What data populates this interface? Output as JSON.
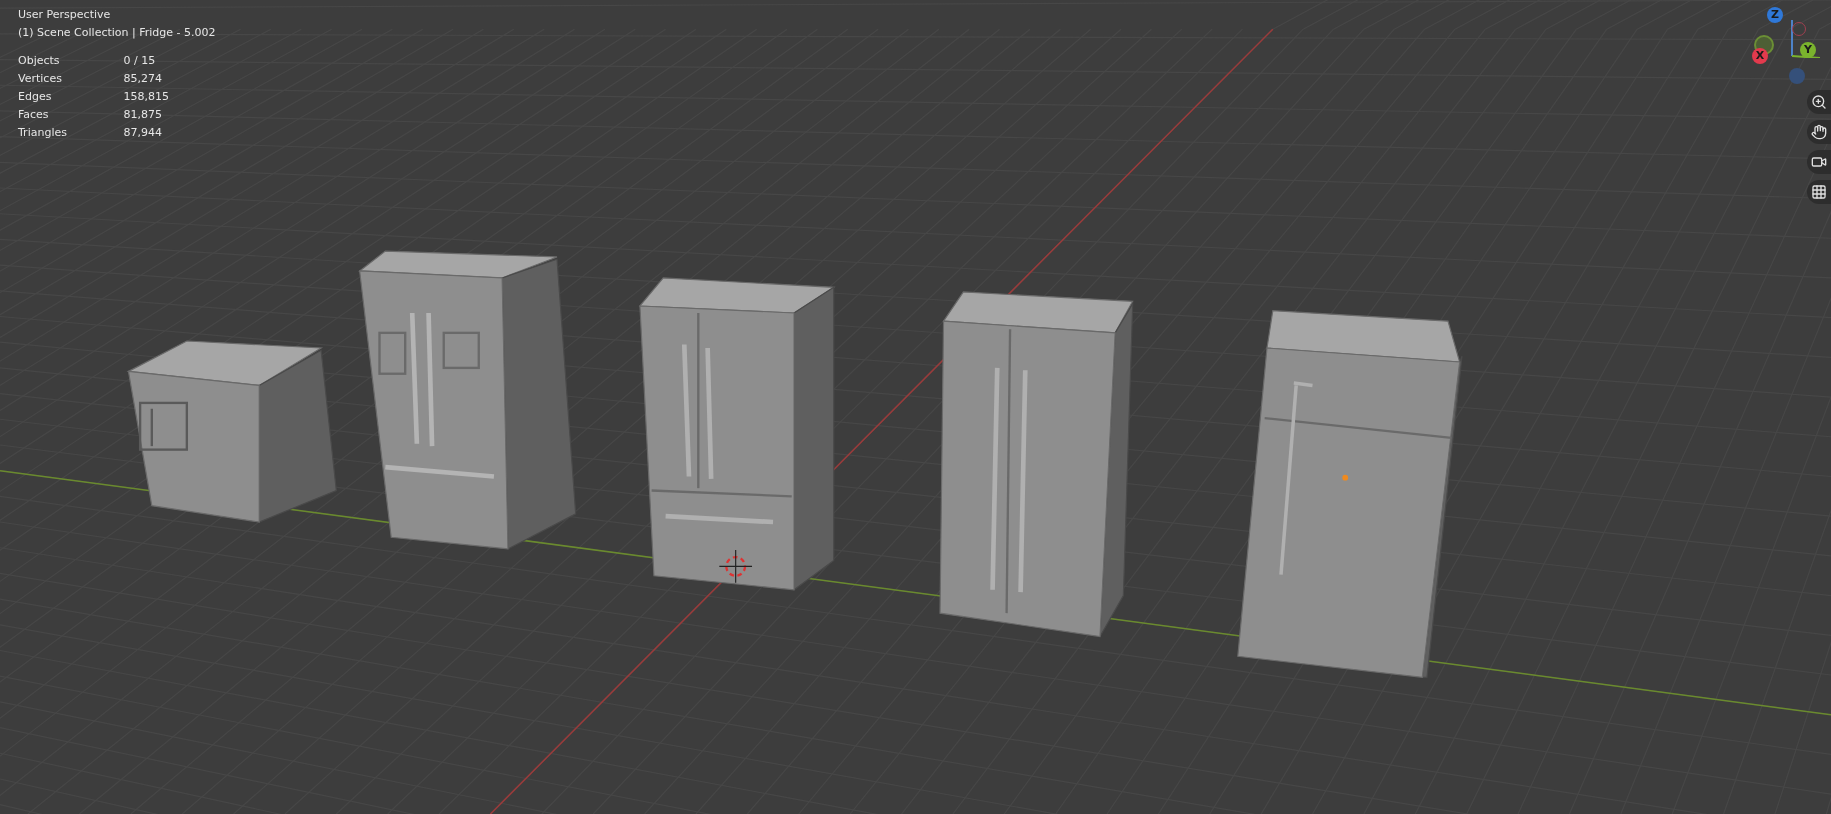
{
  "overlay": {
    "view_name": "User Perspective",
    "collection_line": "(1) Scene Collection | Fridge - 5.002"
  },
  "stats": [
    {
      "label": "Objects",
      "value": "0 / 15"
    },
    {
      "label": "Vertices",
      "value": "85,274"
    },
    {
      "label": "Edges",
      "value": "158,815"
    },
    {
      "label": "Faces",
      "value": "81,875"
    },
    {
      "label": "Triangles",
      "value": "87,944"
    }
  ],
  "gizmo": {
    "axes": [
      {
        "label": "Z",
        "color": "#2f78d8"
      },
      {
        "label": "X",
        "color": "#e23a4d"
      },
      {
        "label": "Y",
        "color": "#7ab32d"
      }
    ]
  }
}
